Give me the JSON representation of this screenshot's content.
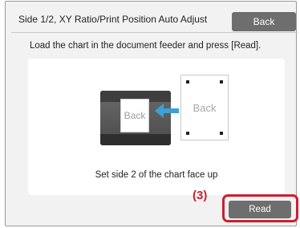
{
  "header": {
    "title": "Side 1/2, XY Ratio/Print Position Auto Adjust",
    "back_label": "Back"
  },
  "instruction": "Load the chart in the document feeder and press [Read].",
  "illustration": {
    "scanner_sheet_label": "Back",
    "chart_sheet_label": "Back",
    "caption": "Set side 2 of the chart face up"
  },
  "annotation": {
    "step_label": "(3)",
    "highlight_color": "#cc1f2d"
  },
  "footer": {
    "read_label": "Read"
  },
  "icons": [
    "arrow-left-icon"
  ]
}
